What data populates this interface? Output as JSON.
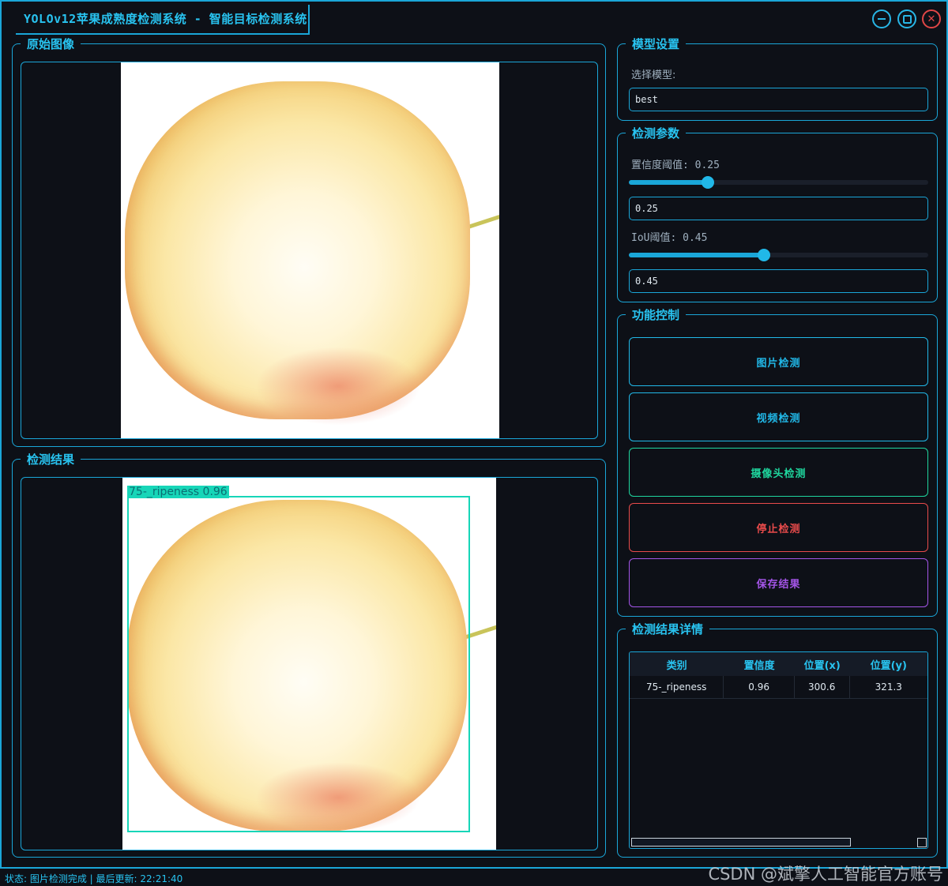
{
  "window": {
    "title": "YOLOv12苹果成熟度检测系统 - 智能目标检测系统"
  },
  "panels": {
    "original_title": "原始图像",
    "result_title": "检测结果"
  },
  "detection_overlay": {
    "label": "75-_ripeness 0.96"
  },
  "model_settings": {
    "title": "模型设置",
    "select_label": "选择模型:",
    "selected_model": "best"
  },
  "detect_params": {
    "title": "检测参数",
    "conf_label": "置信度阈值: 0.25",
    "conf_value": "0.25",
    "conf_fraction": 0.25,
    "iou_label": "IoU阈值: 0.45",
    "iou_value": "0.45",
    "iou_fraction": 0.45
  },
  "function_control": {
    "title": "功能控制",
    "buttons": [
      {
        "label": "图片检测",
        "color": "#21b8e8"
      },
      {
        "label": "视频检测",
        "color": "#21b8e8"
      },
      {
        "label": "摄像头检测",
        "color": "#1fd69e"
      },
      {
        "label": "停止检测",
        "color": "#e94b4b"
      },
      {
        "label": "保存结果",
        "color": "#a455e8"
      }
    ]
  },
  "results_table": {
    "title": "检测结果详情",
    "columns": [
      "类别",
      "置信度",
      "位置(x)",
      "位置(y)"
    ],
    "rows": [
      [
        "75-_ripeness",
        "0.96",
        "300.6",
        "321.3"
      ]
    ]
  },
  "status_bar": {
    "text": "状态: 图片检测完成 | 最后更新: 22:21:40",
    "watermark": "CSDN @斌擎人工智能官方账号"
  }
}
